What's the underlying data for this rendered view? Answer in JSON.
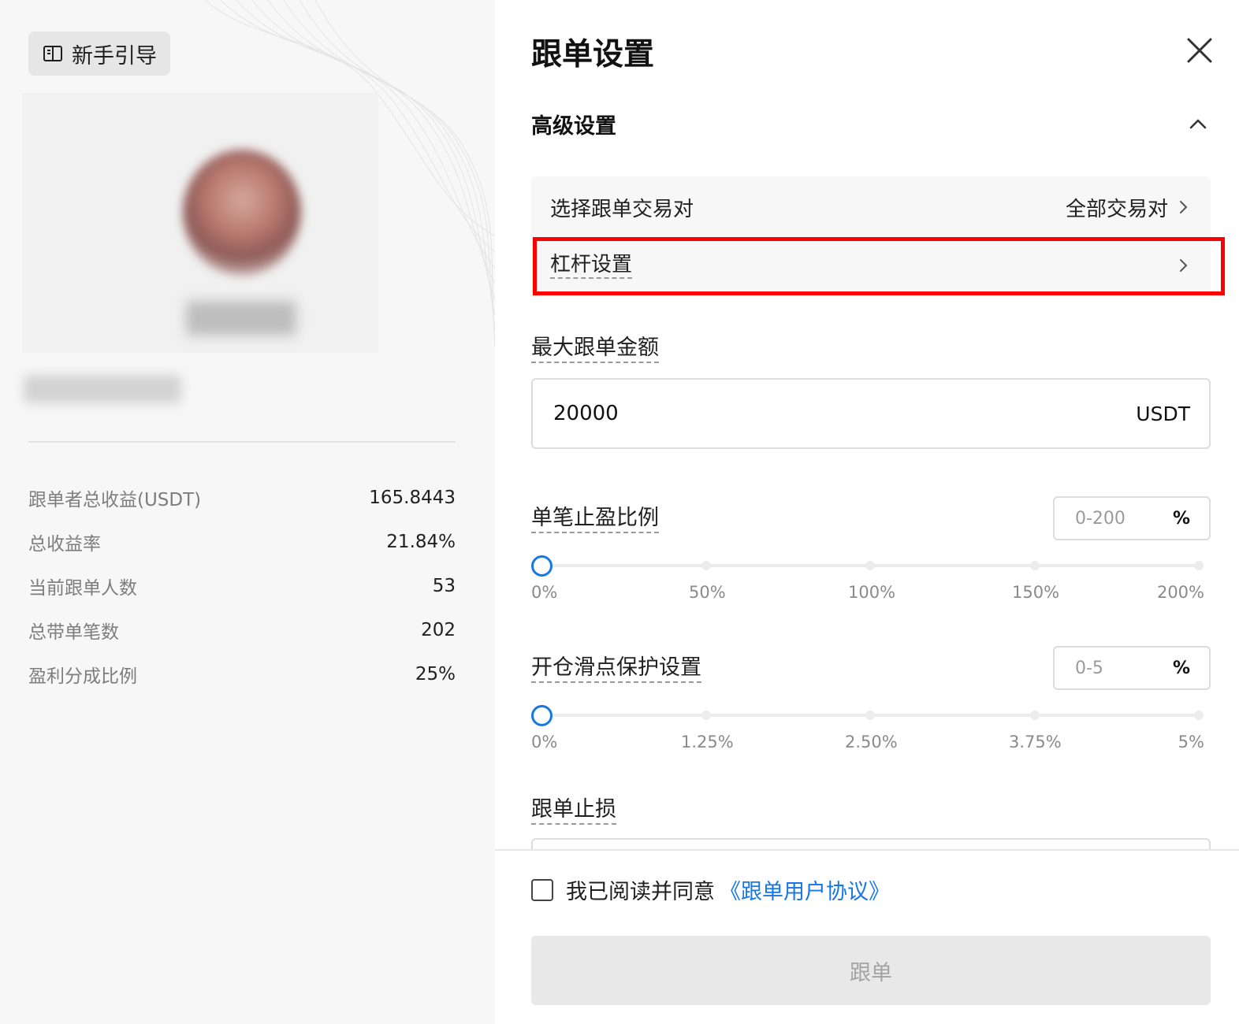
{
  "left": {
    "guide_button": "新手引导",
    "stats": [
      {
        "label": "跟单者总收益(USDT)",
        "value": "165.8443"
      },
      {
        "label": "总收益率",
        "value": "21.84%"
      },
      {
        "label": "当前跟单人数",
        "value": "53"
      },
      {
        "label": "总带单笔数",
        "value": "202"
      },
      {
        "label": "盈利分成比例",
        "value": "25%"
      }
    ]
  },
  "panel": {
    "title": "跟单设置",
    "section_title": "高级设置",
    "pairs": {
      "label": "选择跟单交易对",
      "value": "全部交易对"
    },
    "leverage": {
      "label": "杠杆设置"
    },
    "max_amount": {
      "label": "最大跟单金额",
      "value": "20000",
      "unit": "USDT"
    },
    "take_profit": {
      "label": "单笔止盈比例",
      "placeholder": "0-200",
      "unit": "%",
      "slider_value": 0,
      "ticks": [
        "0%",
        "50%",
        "100%",
        "150%",
        "200%"
      ]
    },
    "slippage": {
      "label": "开仓滑点保护设置",
      "placeholder": "0-5",
      "unit": "%",
      "slider_value": 0,
      "ticks": [
        "0%",
        "1.25%",
        "2.50%",
        "3.75%",
        "5%"
      ]
    },
    "stop_loss": {
      "label": "跟单止损"
    },
    "agreement": {
      "text": "我已阅读并同意",
      "link": "《跟单用户协议》",
      "checked": false
    },
    "follow_button": "跟单"
  },
  "colors": {
    "accent": "#1677e5",
    "highlight": "#ff0000",
    "disabled_button": "#e8e8e8"
  },
  "icons": [
    "guide-book-icon",
    "close-icon",
    "chevron-up-icon",
    "chevron-right-icon"
  ]
}
